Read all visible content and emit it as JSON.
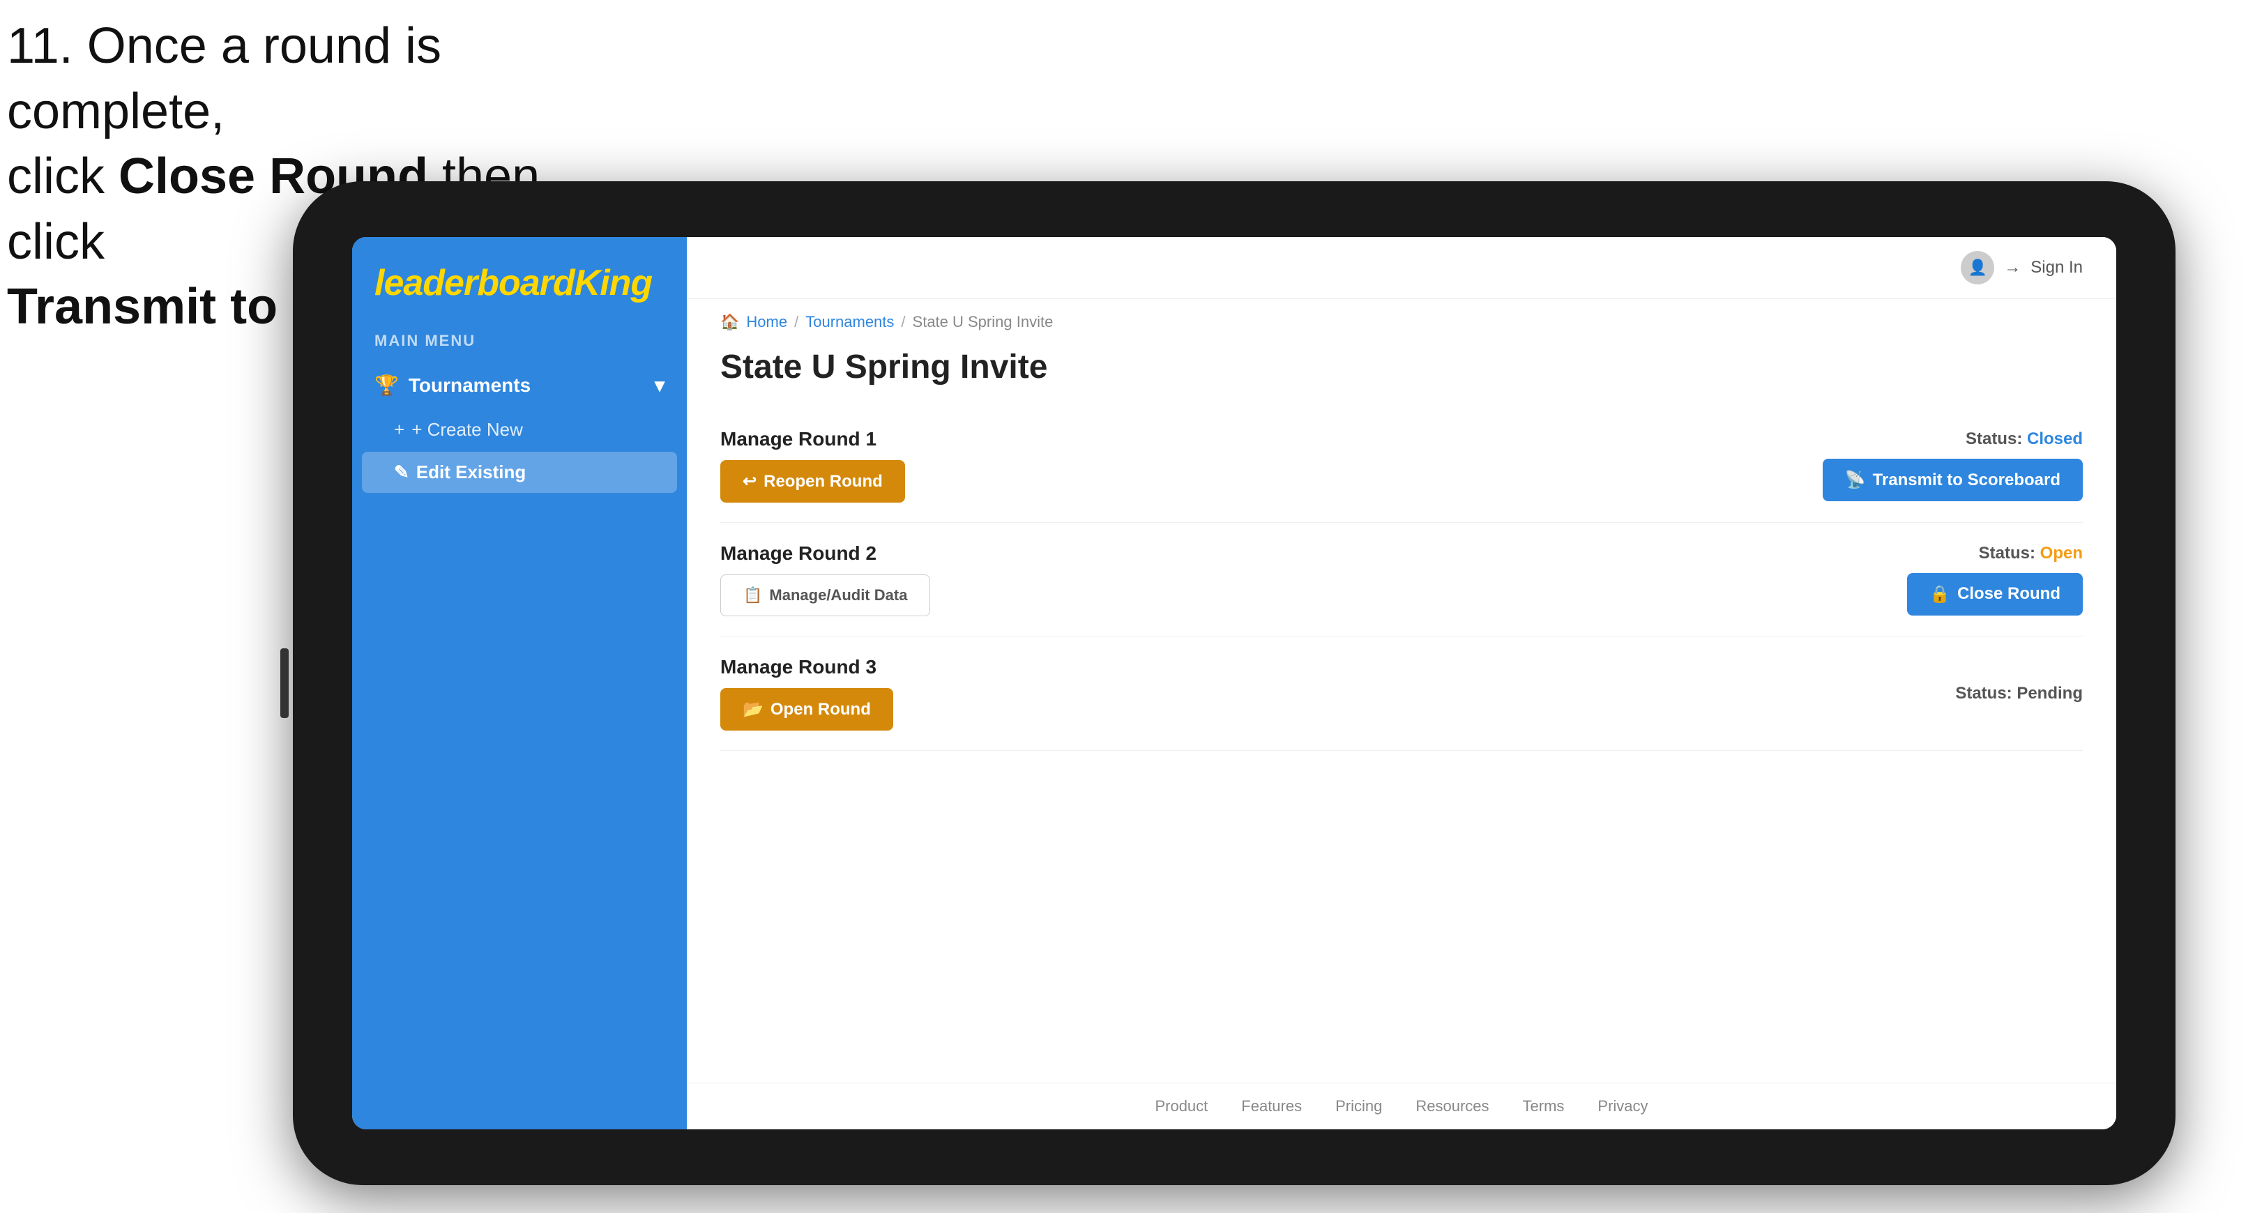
{
  "instruction": {
    "line1": "11. Once a round is complete,",
    "line2_prefix": "click ",
    "line2_bold": "Close Round",
    "line2_suffix": " then click",
    "line3_bold": "Transmit to Scoreboard."
  },
  "sidebar": {
    "logo": {
      "text_normal": "leaderboard",
      "text_highlight": "King"
    },
    "section_label": "MAIN MENU",
    "tournaments_label": "Tournaments",
    "tournaments_icon": "🏆",
    "chevron_icon": "▾",
    "create_new_label": "+ Create New",
    "edit_existing_label": "Edit Existing",
    "edit_icon": "✎"
  },
  "topbar": {
    "sign_in": "Sign In",
    "sign_in_icon": "→"
  },
  "breadcrumb": {
    "home": "Home",
    "sep1": "/",
    "tournaments": "Tournaments",
    "sep2": "/",
    "current": "State U Spring Invite"
  },
  "page": {
    "title": "State U Spring Invite",
    "rounds": [
      {
        "label": "Manage Round 1",
        "status_label": "Status:",
        "status_value": "Closed",
        "status_type": "closed",
        "button1_label": "Reopen Round",
        "button1_type": "gold",
        "button2_label": "Transmit to Scoreboard",
        "button2_type": "blue",
        "show_audit": false
      },
      {
        "label": "Manage Round 2",
        "status_label": "Status:",
        "status_value": "Open",
        "status_type": "open",
        "button1_label": "Manage/Audit Data",
        "button1_type": "outline",
        "button2_label": "Close Round",
        "button2_type": "blue",
        "show_audit": true
      },
      {
        "label": "Manage Round 3",
        "status_label": "Status:",
        "status_value": "Pending",
        "status_type": "pending",
        "button1_label": "Open Round",
        "button1_type": "gold",
        "button2_label": "",
        "button2_type": "none",
        "show_audit": false
      }
    ]
  },
  "footer": {
    "links": [
      "Product",
      "Features",
      "Pricing",
      "Resources",
      "Terms",
      "Privacy"
    ]
  }
}
